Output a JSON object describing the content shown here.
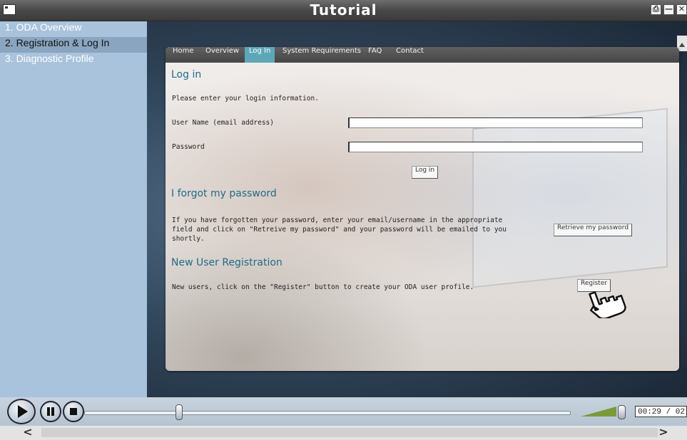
{
  "window": {
    "title": "Tutorial",
    "print_icon": "printer-icon",
    "minimize_icon": "minimize-icon",
    "close_icon": "close-icon"
  },
  "sidebar": {
    "items": [
      {
        "label": "1. ODA Overview"
      },
      {
        "label": "2. Registration & Log In",
        "active": true
      },
      {
        "label": "3. Diagnostic Profile"
      }
    ]
  },
  "nav": {
    "items": [
      {
        "label": "Home"
      },
      {
        "label": "Overview"
      },
      {
        "label": "Log In",
        "active": true
      },
      {
        "label": "System Requirements"
      },
      {
        "label": "FAQ"
      },
      {
        "label": "Contact"
      }
    ]
  },
  "login": {
    "heading": "Log in",
    "instructions": "Please enter your login information.",
    "username_label": "User Name (email address)",
    "username_value": "",
    "password_label": "Password",
    "password_value": "",
    "button": "Log in"
  },
  "forgot": {
    "heading": "I forgot my password",
    "line1": "If you have forgotten your password, enter your email/username in the appropriate",
    "line2": "field and click on \"Retreive my password\" and your password will be emailed to you",
    "line3": "shortly.",
    "button": "Retrieve my password"
  },
  "register": {
    "heading": "New User Registration",
    "text": "New users, click on the \"Register\" button to create your ODA user profile.",
    "button": "Register"
  },
  "player": {
    "time": "00:29 / 02:",
    "progress": 0.19,
    "volume": 0.75,
    "accent": "#7a9a3a"
  },
  "colors": {
    "sidebar": "#a9c3dc",
    "sidebar_active": "#8aa5bf",
    "heading": "#1e6c8a",
    "nav_active": "#5da7b8"
  }
}
